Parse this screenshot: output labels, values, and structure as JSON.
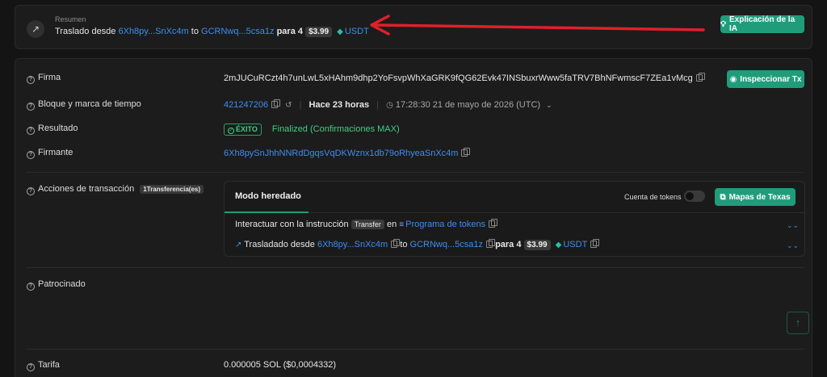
{
  "summary": {
    "label": "Resumen",
    "prefix": "Traslado desde",
    "from": "6Xh8py...SnXc4m",
    "to_word": "to",
    "to": "GCRNwq...5csa1z",
    "para": "para 4",
    "price": "$3.99",
    "token": "USDT",
    "ai_button": "Explicación de la IA"
  },
  "signature": {
    "label": "Firma",
    "value": "2mJUCuRCzt4h7unLwL5xHAhm9dhp2YoFsvpWhXaGRK9fQG62Evk47INSbuxrWww5faTRV7BhNFwmscF7ZEa1vMcg",
    "inspect_button": "Inspeccionar Tx"
  },
  "block": {
    "label": "Bloque y marca de tiempo",
    "number": "421247206",
    "ago": "Hace 23 horas",
    "timestamp": "17:28:30 21 de mayo de 2026 (UTC)"
  },
  "result": {
    "label": "Resultado",
    "badge": "ÉXITO",
    "status": "Finalized (Confirmaciones MAX)"
  },
  "signer": {
    "label": "Firmante",
    "value": "6Xh8pySnJhhNNRdDgqsVqDKWznx1db79oRhyeaSnXc4m"
  },
  "actions": {
    "label": "Acciones de transacción",
    "count_badge": "1Transferencia(es)",
    "mode": "Modo heredado",
    "token_account_label": "Cuenta de tokens",
    "maps_button": "Mapas de Texas",
    "instruction_prefix": "Interactuar con la instrucción",
    "instruction_tag": "Transfer",
    "instruction_en": "en",
    "program": "Programa de tokens",
    "move_prefix": "Trasladado desde",
    "move_from": "6Xh8py...SnXc4m",
    "move_to_word": "to",
    "move_to": "GCRNwq...5csa1z",
    "move_para": "para 4",
    "move_price": "$3.99",
    "move_token": "USDT"
  },
  "sponsored": {
    "label": "Patrocinado"
  },
  "fee": {
    "label": "Tarifa",
    "value": "0.000005 SOL ($0,0004332)"
  }
}
